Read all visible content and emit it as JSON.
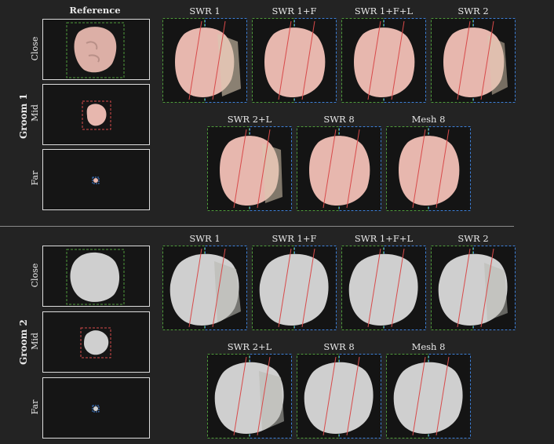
{
  "reference_header": "Reference",
  "row_labels": [
    "Close",
    "Mid",
    "Far"
  ],
  "colors": {
    "background": "#232323",
    "green_dash": "#4f9a3c",
    "red_dash": "#d84a4a",
    "blue_dash": "#3e7fd6",
    "groom1_fill": "#e7b7ae",
    "groom2_fill": "#cfcfcf"
  },
  "groups": [
    {
      "label": "Groom 1",
      "top_methods": [
        "SWR 1",
        "SWR 1+F",
        "SWR 1+F+L",
        "SWR 2"
      ],
      "bottom_methods": [
        "SWR 2+L",
        "SWR 8",
        "Mesh 8"
      ]
    },
    {
      "label": "Groom 2",
      "top_methods": [
        "SWR 1",
        "SWR 1+F",
        "SWR 1+F+L",
        "SWR 2"
      ],
      "bottom_methods": [
        "SWR 2+L",
        "SWR 8",
        "Mesh 8"
      ]
    }
  ]
}
